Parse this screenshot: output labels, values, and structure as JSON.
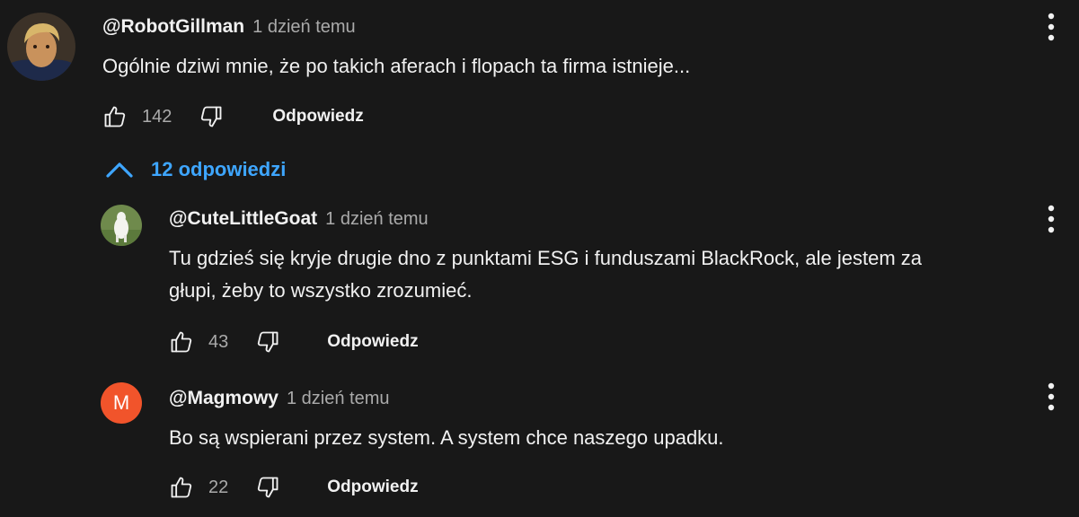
{
  "comments": [
    {
      "author": "@RobotGillman",
      "time": "1 dzień temu",
      "text": "Ogólnie dziwi mnie, że po takich aferach i flopach ta firma istnieje...",
      "likes": "142",
      "reply_label": "Odpowiedz"
    }
  ],
  "replies_toggle": {
    "label": "12 odpowiedzi",
    "icon": "chevron-up-icon",
    "color": "#3ea6ff"
  },
  "replies": [
    {
      "author": "@CuteLittleGoat",
      "time": "1 dzień temu",
      "text_line1": "Tu gdzieś się kryje drugie dno z punktami ESG i funduszami BlackRock, ale jestem za",
      "text_line2": "głupi, żeby to wszystko zrozumieć.",
      "likes": "43",
      "reply_label": "Odpowiedz"
    },
    {
      "author": "@Magmowy",
      "avatar_letter": "M",
      "avatar_color": "#f1542b",
      "time": "1 dzień temu",
      "text": "Bo są wspierani przez system. A system chce naszego upadku.",
      "likes": "22",
      "reply_label": "Odpowiedz"
    }
  ]
}
